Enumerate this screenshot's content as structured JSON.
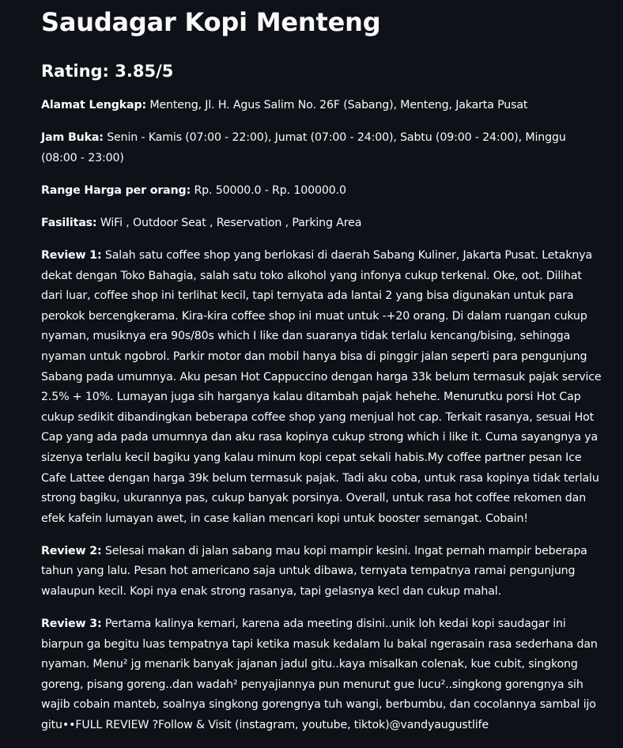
{
  "title": "Saudagar Kopi Menteng",
  "rating": "Rating: 3.85/5",
  "fields": [
    {
      "label": "Alamat Lengkap:",
      "value": " Menteng, Jl. H. Agus Salim No. 26F (Sabang), Menteng, Jakarta Pusat"
    },
    {
      "label": "Jam Buka:",
      "value": " Senin - Kamis (07:00 - 22:00), Jumat (07:00 - 24:00), Sabtu (09:00 - 24:00), Minggu (08:00 - 23:00)"
    },
    {
      "label": "Range Harga per orang:",
      "value": " Rp. 50000.0 - Rp. 100000.0"
    },
    {
      "label": "Fasilitas:",
      "value": " WiFi , Outdoor Seat , Reservation , Parking Area"
    }
  ],
  "reviews": [
    {
      "label": "Review 1:",
      "text": " Salah satu coffee shop yang berlokasi di daerah Sabang Kuliner, Jakarta Pusat. Letaknya dekat dengan Toko Bahagia, salah satu toko alkohol yang infonya cukup terkenal. Oke, oot. Dilihat dari luar, coffee shop ini terlihat kecil, tapi ternyata ada lantai 2 yang bisa digunakan untuk para perokok bercengkerama. Kira-kira coffee shop ini muat untuk -+20 orang. Di dalam ruangan cukup nyaman, musiknya era 90s/80s which I like dan suaranya tidak terlalu kencang/bising, sehingga nyaman untuk ngobrol. Parkir motor dan mobil hanya bisa di pinggir jalan seperti para pengunjung Sabang pada umumnya. Aku pesan Hot Cappuccino dengan harga 33k belum termasuk pajak service 2.5% + 10%. Lumayan juga sih harganya kalau ditambah pajak hehehe. Menurutku porsi Hot Cap cukup sedikit dibandingkan beberapa coffee shop yang menjual hot cap. Terkait rasanya, sesuai Hot Cap yang ada pada umumnya dan aku rasa kopinya cukup strong which i like it. Cuma sayangnya ya sizenya terlalu kecil bagiku yang kalau minum kopi cepat sekali habis.My coffee partner pesan Ice Cafe Lattee dengan harga 39k belum termasuk pajak. Tadi aku coba, untuk rasa kopinya tidak terlalu strong bagiku, ukurannya pas, cukup banyak porsinya.  Overall, untuk rasa hot coffee rekomen dan efek kafein lumayan awet, in case kalian mencari kopi untuk booster semangat. Cobain!"
    },
    {
      "label": "Review 2:",
      "text": " Selesai makan di jalan sabang mau kopi mampir kesini. Ingat pernah mampir beberapa tahun yang lalu. Pesan hot americano saja untuk dibawa, ternyata tempatnya ramai pengunjung walaupun kecil. Kopi nya enak strong rasanya, tapi gelasnya kecl dan cukup mahal."
    },
    {
      "label": "Review 3:",
      "text": " Pertama kalinya kemari, karena ada meeting disini..unik loh kedai kopi saudagar ini biarpun ga begitu luas tempatnya tapi ketika masuk kedalam lu bakal ngerasain rasa sederhana dan nyaman. Menu² jg menarik banyak jajanan jadul gitu..kaya misalkan colenak, kue cubit, singkong goreng, pisang goreng..dan wadah² penyajiannya pun menurut gue lucu²..singkong gorengnya sih wajib cobain manteb, soalnya singkong gorengnya tuh wangi, berbumbu, dan cocolannya sambal ijo gitu••FULL REVIEW ?Follow & Visit (instagram, youtube, tiktok)@vandyaugustlife"
    }
  ]
}
